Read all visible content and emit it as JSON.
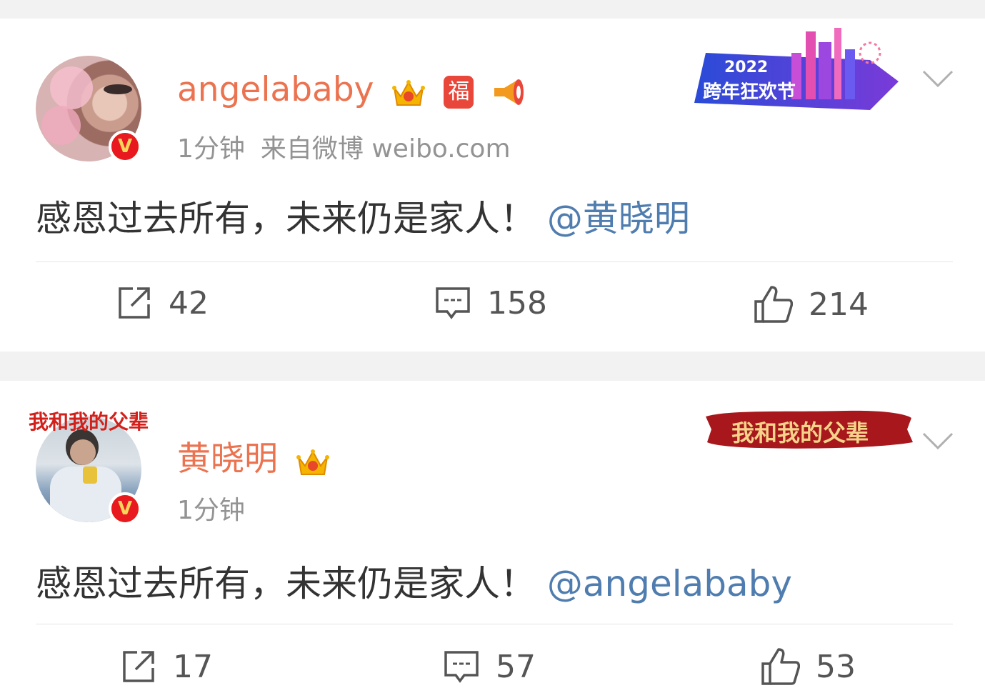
{
  "posts": [
    {
      "username": "angelababy",
      "time": "1分钟",
      "source": "来自微博 weibo.com",
      "text": "感恩过去所有，未来仍是家人！",
      "mention": "@黄晓明",
      "emblem": {
        "year": "2022",
        "label": "跨年狂欢节"
      },
      "actions": {
        "repost": "42",
        "comment": "158",
        "like": "214"
      }
    },
    {
      "username": "黄晓明",
      "time": "1分钟",
      "source": "",
      "text": "感恩过去所有，未来仍是家人！",
      "mention": "@angelababy",
      "emblem": {
        "label": "我和我的父辈"
      },
      "avatar_caption": "我和我的父辈",
      "actions": {
        "repost": "17",
        "comment": "57",
        "like": "53"
      }
    }
  ],
  "icons": {
    "verified": "verified-v-icon",
    "crown": "crown-badge-icon",
    "fu": "福",
    "megaphone": "megaphone-icon"
  },
  "colors": {
    "username": "#eb7350",
    "mention": "#507daf",
    "meta": "#939393",
    "verified": "#e8191f"
  }
}
